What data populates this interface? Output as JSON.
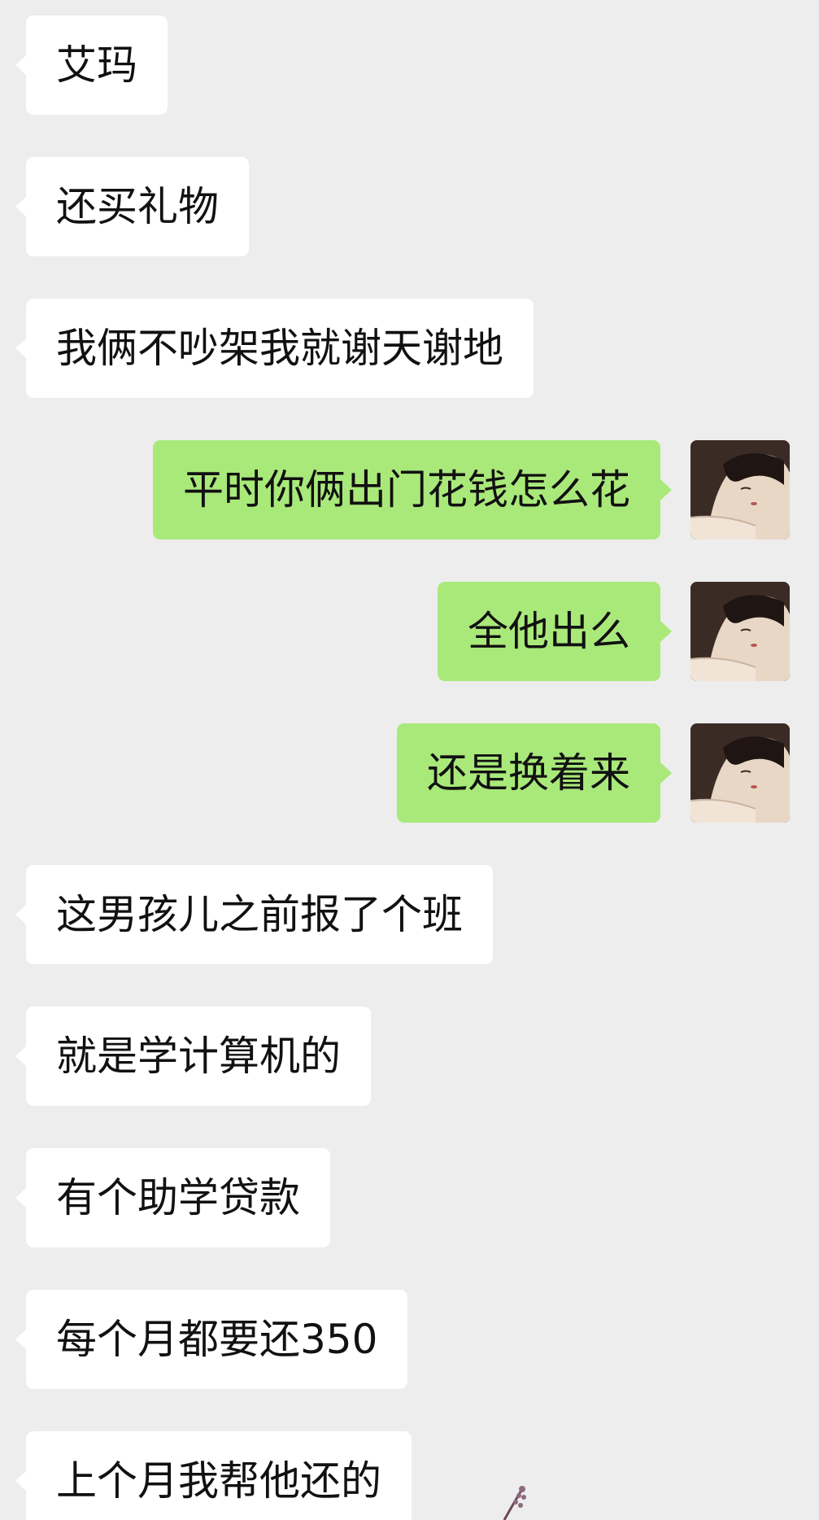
{
  "conversation": {
    "messages": [
      {
        "side": "in",
        "text": "艾玛"
      },
      {
        "side": "in",
        "text": "还买礼物"
      },
      {
        "side": "in",
        "text": "我俩不吵架我就谢天谢地"
      },
      {
        "side": "out",
        "text": "平时你俩出门花钱怎么花"
      },
      {
        "side": "out",
        "text": "全他出么"
      },
      {
        "side": "out",
        "text": "还是换着来"
      },
      {
        "side": "in",
        "text": "这男孩儿之前报了个班"
      },
      {
        "side": "in",
        "text": "就是学计算机的"
      },
      {
        "side": "in",
        "text": "有个助学贷款"
      },
      {
        "side": "in",
        "text": "每个月都要还350"
      },
      {
        "side": "in",
        "text": "上个月我帮他还的"
      }
    ]
  },
  "theme": {
    "background": "#ededed",
    "incoming_bubble": "#ffffff",
    "outgoing_bubble": "#a9e97a",
    "text": "#111111"
  },
  "icons": {
    "avatar": "avatar-girl-illustration",
    "decoration": "flower-sticker-icon"
  }
}
